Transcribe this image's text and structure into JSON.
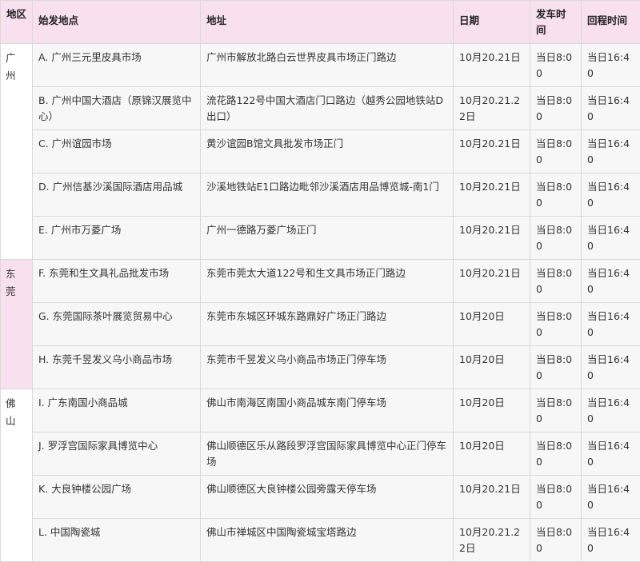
{
  "headers": {
    "region": "地区",
    "start": "始发地点",
    "address": "地址",
    "date": "日期",
    "depart": "发车时间",
    "return": "回程时间"
  },
  "groups": [
    {
      "region": "广州",
      "rows": [
        {
          "start": "A. 广州三元里皮具市场",
          "address": "广州市解放北路白云世界皮具市场正门路边",
          "date": "10月20.21日",
          "depart": "当日8:00",
          "return": "当日16:40"
        },
        {
          "start": "B. 广州中国大酒店（原锦汉展览中心）",
          "address": "流花路122号中国大酒店门口路边（越秀公园地铁站D出口）",
          "date": "10月20.21.22日",
          "depart": "当日8:00",
          "return": "当日16:40"
        },
        {
          "start": "C. 广州谊园市场",
          "address": "黄沙谊园B馆文具批发市场正门",
          "date": "10月20.21日",
          "depart": "当日8:00",
          "return": "当日16:40"
        },
        {
          "start": "D. 广州信基沙溪国际酒店用品城",
          "address": "沙溪地铁站E1口路边毗邻沙溪酒店用品博览城-南1门",
          "date": "10月20.21日",
          "depart": "当日8:00",
          "return": "当日16:40"
        },
        {
          "start": "E. 广州市万菱广场",
          "address": "广州一德路万菱广场正门",
          "date": "10月20.21日",
          "depart": "当日8:00",
          "return": "当日16:40"
        }
      ]
    },
    {
      "region": "东莞",
      "rows": [
        {
          "start": "F. 东莞和生文具礼品批发市场",
          "address": "东莞市莞太大道122号和生文具市场正门路边",
          "date": "10月20.21日",
          "depart": "当日8:00",
          "return": "当日16:40"
        },
        {
          "start": "G. 东莞国际茶叶展览贸易中心",
          "address": "东莞市东城区环城东路鼎好广场正门路边",
          "date": "10月20日",
          "depart": "当日8:00",
          "return": "当日16:40"
        },
        {
          "start": "H. 东莞千昱发义乌小商品市场",
          "address": "东莞市千昱发义乌小商品市场正门停车场",
          "date": "10月20日",
          "depart": "当日8:00",
          "return": "当日16:40"
        }
      ]
    },
    {
      "region": "佛山",
      "rows": [
        {
          "start": "I. 广东南国小商品城",
          "address": "佛山市南海区南国小商品城东南门停车场",
          "date": "10月20日",
          "depart": "当日8:00",
          "return": "当日16:40"
        },
        {
          "start": "J. 罗浮宫国际家具博览中心",
          "address": "佛山顺德区乐从路段罗浮宫国际家具博览中心正门停车场",
          "date": "10月20日",
          "depart": "当日8:00",
          "return": "当日16:40"
        },
        {
          "start": "K. 大良钟楼公园广场",
          "address": "佛山顺德区大良钟楼公园旁露天停车场",
          "date": "10月20.21日",
          "depart": "当日8:00",
          "return": "当日16:40"
        },
        {
          "start": "L. 中国陶瓷城",
          "address": "佛山市禅城区中国陶瓷城宝塔路边",
          "date": "10月20.21.22日",
          "depart": "当日8:00",
          "return": "当日16:40"
        }
      ]
    }
  ]
}
